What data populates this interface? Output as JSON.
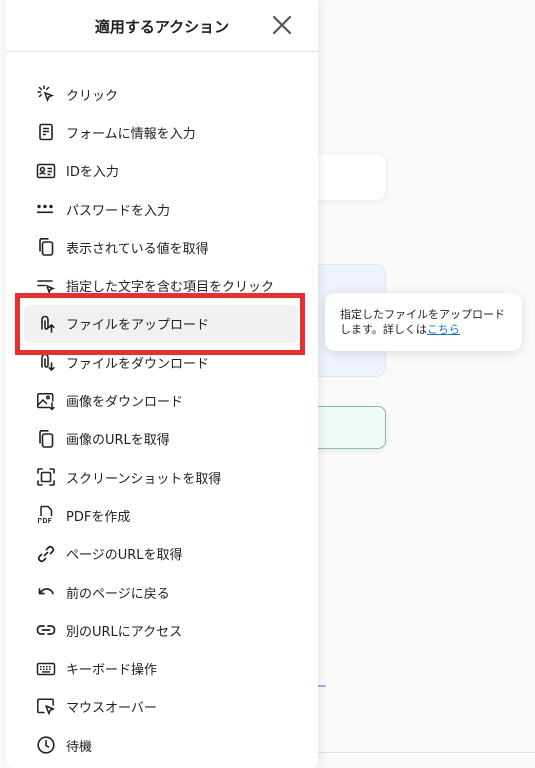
{
  "panel": {
    "title": "適用するアクション",
    "items": [
      {
        "label": "クリック",
        "icon": "click-icon"
      },
      {
        "label": "フォームに情報を入力",
        "icon": "form-icon"
      },
      {
        "label": "IDを入力",
        "icon": "id-card-icon"
      },
      {
        "label": "パスワードを入力",
        "icon": "password-icon"
      },
      {
        "label": "表示されている値を取得",
        "icon": "copy-icon"
      },
      {
        "label": "指定した文字を含む項目をクリック",
        "icon": "text-click-icon"
      },
      {
        "label": "ファイルをアップロード",
        "icon": "paperclip-upload-icon"
      },
      {
        "label": "ファイルをダウンロード",
        "icon": "paperclip-download-icon"
      },
      {
        "label": "画像をダウンロード",
        "icon": "image-download-icon"
      },
      {
        "label": "画像のURLを取得",
        "icon": "copy-icon"
      },
      {
        "label": "スクリーンショットを取得",
        "icon": "screenshot-icon"
      },
      {
        "label": "PDFを作成",
        "icon": "pdf-icon"
      },
      {
        "label": "ページのURLを取得",
        "icon": "link-icon"
      },
      {
        "label": "前のページに戻る",
        "icon": "undo-icon"
      },
      {
        "label": "別のURLにアクセス",
        "icon": "chain-link-icon"
      },
      {
        "label": "キーボード操作",
        "icon": "keyboard-icon"
      },
      {
        "label": "マウスオーバー",
        "icon": "mouse-over-icon"
      },
      {
        "label": "待機",
        "icon": "clock-icon"
      }
    ]
  },
  "tooltip": {
    "text": "指定したファイルをアップロードします。詳しくは",
    "link": "こちら"
  },
  "background": {
    "link_fragment": "ー"
  },
  "colors": {
    "highlight_border": "#e8312d",
    "link": "#1a73c8"
  }
}
